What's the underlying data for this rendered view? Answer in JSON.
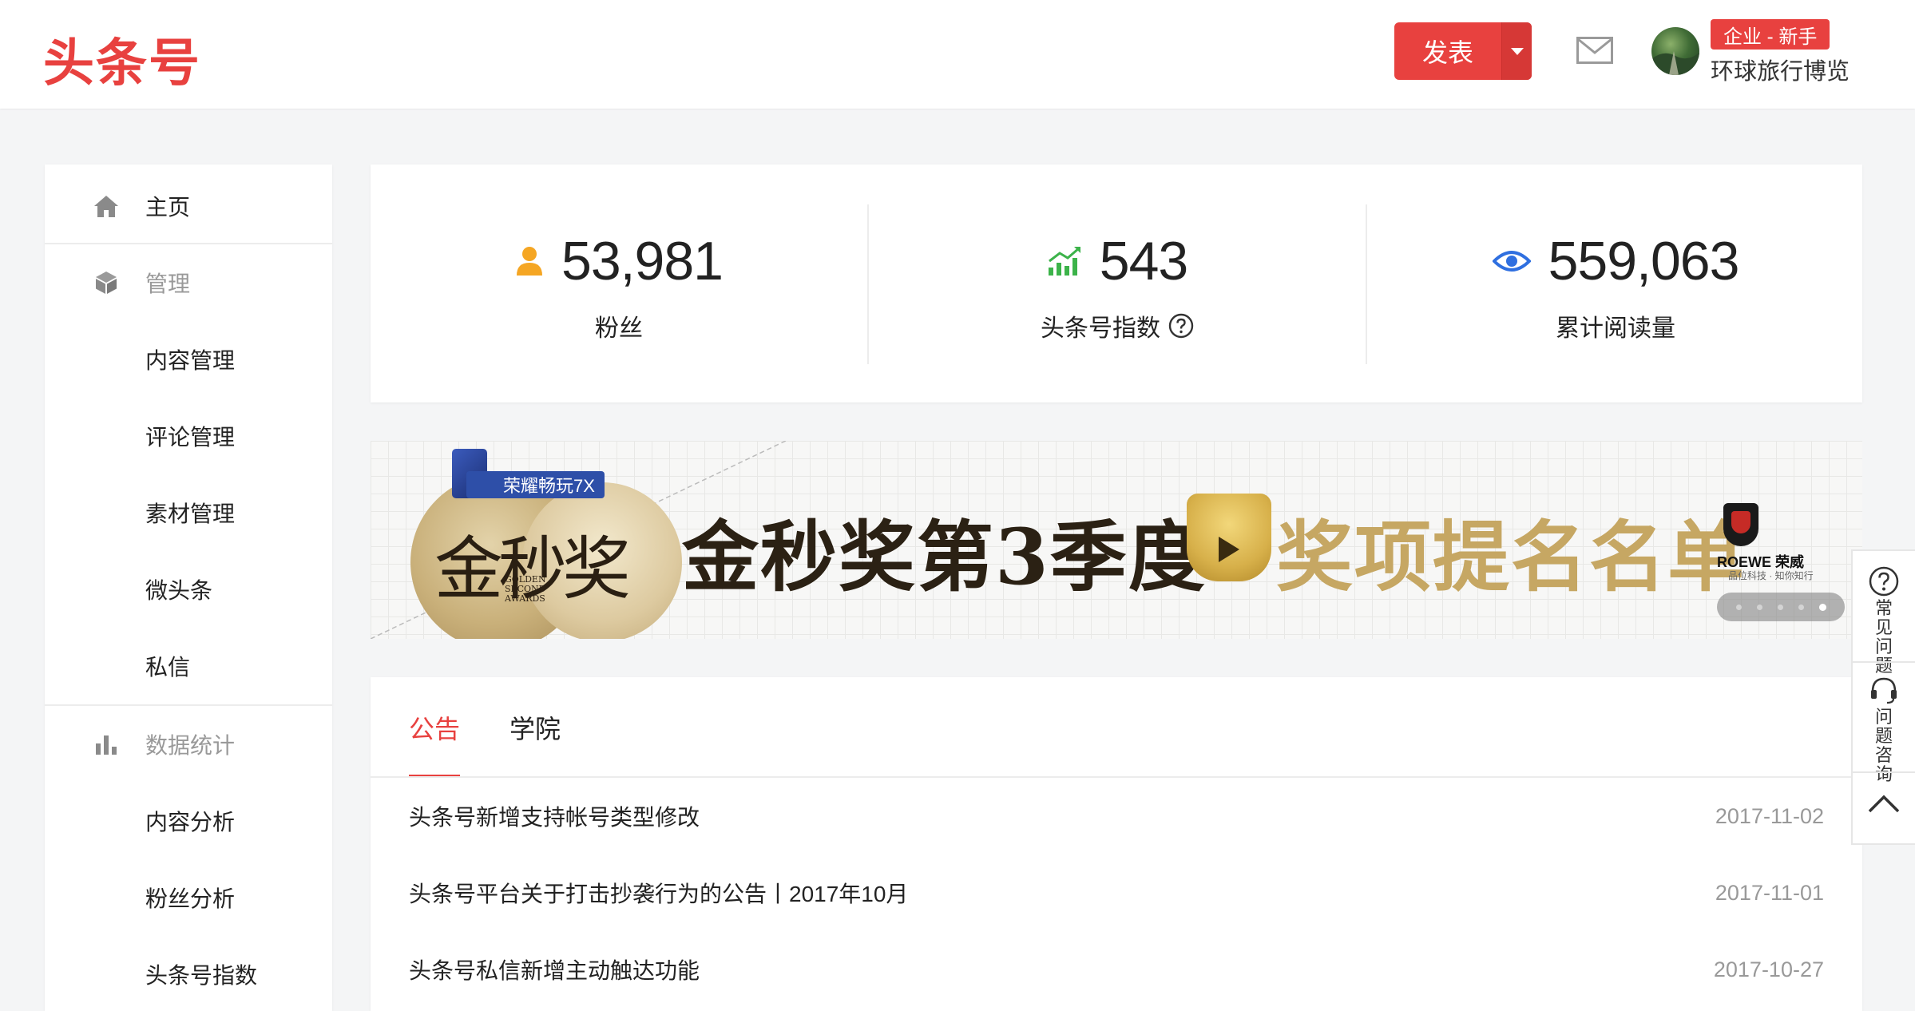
{
  "header": {
    "logo": "头条号",
    "publish_label": "发表",
    "badge": "企业 - 新手",
    "username": "环球旅行博览"
  },
  "sidebar": {
    "home": "主页",
    "manage": "管理",
    "manage_items": [
      "内容管理",
      "评论管理",
      "素材管理",
      "微头条",
      "私信"
    ],
    "stats": "数据统计",
    "stats_items": [
      "内容分析",
      "粉丝分析",
      "头条号指数"
    ]
  },
  "stats": {
    "fans_value": "53,981",
    "fans_label": "粉丝",
    "index_value": "543",
    "index_label": "头条号指数",
    "reads_value": "559,063",
    "reads_label": "累计阅读量"
  },
  "banner": {
    "phone_tag": "荣耀畅玩7X",
    "medal_text": "金秒奖",
    "medal_sub": [
      "GOLDEN",
      "SECOND",
      "AWARDS"
    ],
    "title": "金秒奖第3季度",
    "title_highlight": "奖项提名名单",
    "sponsor": "ROEWE 荣威",
    "sponsor_sub": "品位科技 · 知你知行",
    "slide_count": 5,
    "active_slide": 5
  },
  "notice": {
    "tabs": [
      "公告",
      "学院"
    ],
    "active_tab": 0,
    "items": [
      {
        "title": "头条号新增支持帐号类型修改",
        "date": "2017-11-02"
      },
      {
        "title": "头条号平台关于打击抄袭行为的公告丨2017年10月",
        "date": "2017-11-01"
      },
      {
        "title": "头条号私信新增主动触达功能",
        "date": "2017-10-27"
      }
    ]
  },
  "float": {
    "faq": "常见问题",
    "consult": "问题咨询"
  },
  "colors": {
    "brand": "#e8413f",
    "fans_icon": "#f5a623",
    "index_icon": "#3cb34a",
    "reads_icon": "#2f6fe0"
  }
}
